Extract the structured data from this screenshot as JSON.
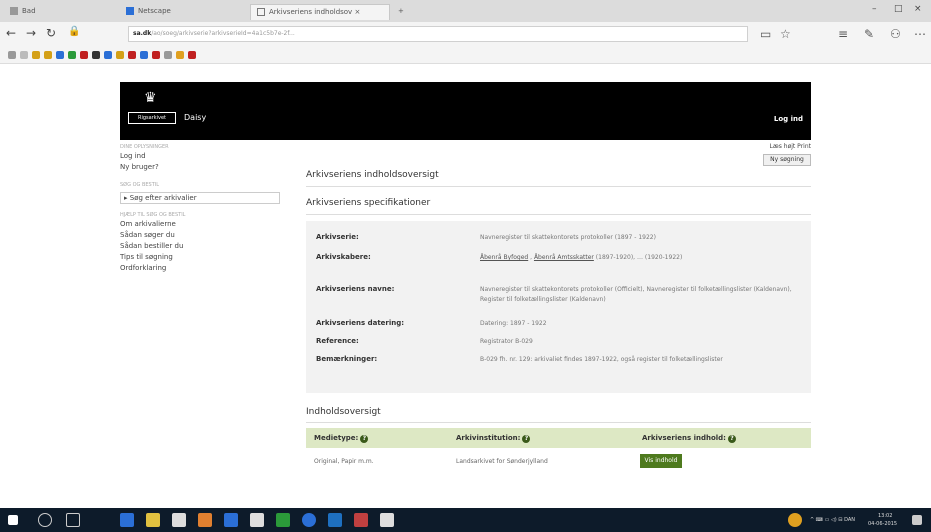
{
  "browser": {
    "tabs": [
      {
        "label": "Bad",
        "icon": "page-icon"
      },
      {
        "label": "Netscape",
        "icon": "bookmark-icon"
      },
      {
        "label": "Arkivseriens indholdsov",
        "icon": "page-icon",
        "active": true
      }
    ],
    "url_domain": "sa.dk",
    "url_rest": "/ao/soeg/arkivserie?arkivserieId=4a1c5b7e-2f...",
    "window_controls": [
      "–",
      "□",
      "×"
    ]
  },
  "site": {
    "brand": "Rigsarkivet",
    "app_name": "Daisy",
    "logout_label": "Log ind",
    "toplinks": "Læs højt  Print",
    "search_button": "Ny søgning"
  },
  "sidebar": {
    "sections": [
      {
        "heading": "Dine oplysninger",
        "items": [
          "Log ind",
          "Ny bruger?"
        ]
      },
      {
        "heading": "Søg og bestil",
        "button": "Søg efter arkivalier"
      },
      {
        "heading": "Hjælp til søg og bestil",
        "items": [
          "Om arkivalierne",
          "Sådan søger du",
          "Sådan bestiller du",
          "Tips til søgning",
          "Ordforklaring"
        ]
      }
    ]
  },
  "main": {
    "title": "Arkivseriens indholdsoversigt",
    "spec_heading": "Arkivseriens specifikationer",
    "specs": [
      {
        "label": "Arkivserie:",
        "value": "Navneregister til skattekontorets protokoller (1897 - 1922)"
      },
      {
        "label": "Arkivskabere:",
        "value_links": [
          "Åbenrå Byfoged",
          "Åbenrå Amtsskatter"
        ],
        "value": "(1897-1920), … (1920-1922)"
      },
      {
        "label": "Arkivseriens navne:",
        "value": "Navneregister til skattekontorets protokoller (Officielt), Navneregister til folketællingslister (Kaldenavn), Register til folketællingslister (Kaldenavn)"
      },
      {
        "label": "Arkivseriens datering:",
        "value": "Datering: 1897 - 1922"
      },
      {
        "label": "Reference:",
        "value": "Registrator B-029"
      },
      {
        "label": "Bemærkninger:",
        "value": "B-029 fh. nr. 129: arkivaliet findes 1897-1922, også register til folketællingslister"
      }
    ],
    "content_heading": "Indholdsoversigt",
    "table": {
      "headers": [
        "Medietype:",
        "Arkivinstitution:",
        "Arkivseriens indhold:"
      ],
      "row": {
        "medietype": "Original, Papir m.m.",
        "institution": "Landsarkivet for Sønderjylland",
        "button": "Vis indhold"
      }
    }
  },
  "taskbar": {
    "clock_time": "13:02",
    "clock_date": "04-06-2015"
  }
}
